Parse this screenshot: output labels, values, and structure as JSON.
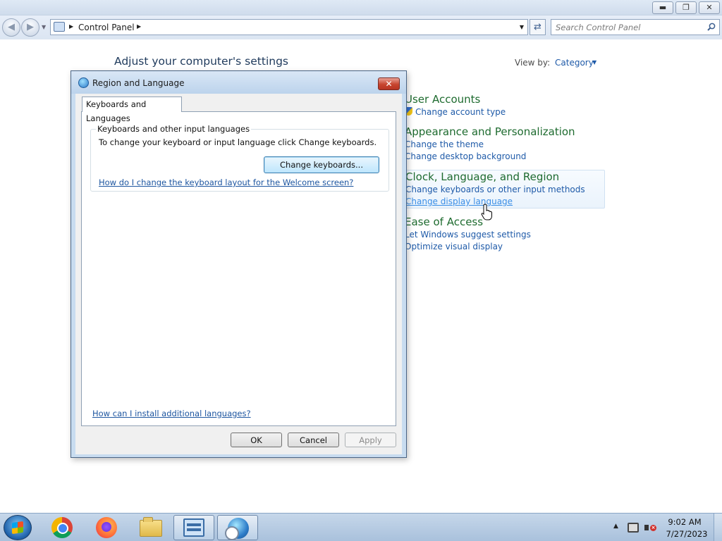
{
  "explorer": {
    "breadcrumb": [
      "Control Panel"
    ],
    "search_placeholder": "Search Control Panel",
    "page_title": "Adjust your computer's settings",
    "view_by_label": "View by:",
    "view_by_value": "Category",
    "categories": [
      {
        "title": "User Accounts",
        "links": [
          "Change account type"
        ]
      },
      {
        "title": "Appearance and Personalization",
        "links": [
          "Change the theme",
          "Change desktop background"
        ]
      },
      {
        "title": "Clock, Language, and Region",
        "links": [
          "Change keyboards or other input methods",
          "Change display language"
        ]
      },
      {
        "title": "Ease of Access",
        "links": [
          "Let Windows suggest settings",
          "Optimize visual display"
        ]
      }
    ]
  },
  "dialog": {
    "title": "Region and Language",
    "tab_label": "Keyboards and Languages",
    "group_title": "Keyboards and other input languages",
    "group_description": "To change your keyboard or input language click Change keyboards.",
    "change_keyboards_label": "Change keyboards...",
    "welcome_link": "How do I change the keyboard layout for the Welcome screen?",
    "install_link": "How can I install additional languages?",
    "ok_label": "OK",
    "cancel_label": "Cancel",
    "apply_label": "Apply"
  },
  "taskbar": {
    "pinned": [
      "chrome-icon",
      "firefox-icon",
      "explorer-icon",
      "control-panel-icon",
      "region-language-icon"
    ],
    "clock_time": "9:02 AM",
    "clock_date": "7/27/2023"
  },
  "colors": {
    "category_title": "#1e6b2f",
    "link": "#1e5aa8",
    "link_hover": "#3a8ee6",
    "dialog_link": "#1e56a0"
  }
}
